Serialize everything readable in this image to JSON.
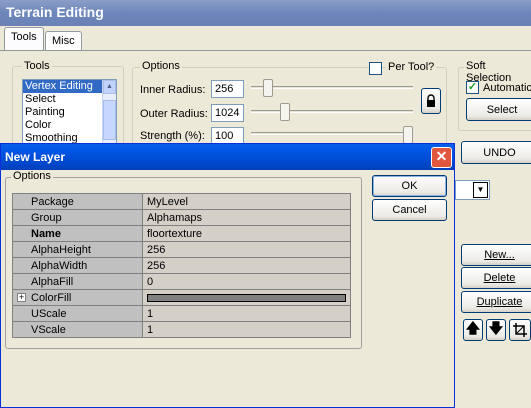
{
  "back_window": {
    "title": "Terrain Editing",
    "tabs": [
      {
        "label": "Tools"
      },
      {
        "label": "Misc"
      }
    ],
    "tools_group": {
      "label": "Tools",
      "items": [
        "Vertex Editing",
        "Select",
        "Painting",
        "Color",
        "Smoothing"
      ]
    },
    "options_group": {
      "label": "Options",
      "per_tool_label": "Per Tool?",
      "inner_radius_label": "Inner Radius:",
      "inner_radius_value": "256",
      "inner_radius_level": 0.08,
      "outer_radius_label": "Outer Radius:",
      "outer_radius_value": "1024",
      "outer_radius_level": 0.19,
      "strength_label": "Strength (%):",
      "strength_value": "100",
      "strength_level": 1.0
    },
    "soft_selection": {
      "label": "Soft Selection",
      "automatic_label": "Automatic",
      "automatic_checked": true,
      "select_label": "Select"
    },
    "undo_label": "UNDO",
    "new_label": "New...",
    "delete_label": "Delete",
    "duplicate_label": "Duplicate"
  },
  "dialog": {
    "title": "New Layer",
    "close_symbol": "✕",
    "options_label": "Options",
    "ok_label": "OK",
    "cancel_label": "Cancel",
    "properties": [
      {
        "key": "Package",
        "value": "MyLevel",
        "bold": false,
        "expandable": false
      },
      {
        "key": "Group",
        "value": "Alphamaps",
        "bold": false,
        "expandable": false
      },
      {
        "key": "Name",
        "value": "floortexture",
        "bold": true,
        "expandable": false
      },
      {
        "key": "AlphaHeight",
        "value": "256",
        "bold": false,
        "expandable": false
      },
      {
        "key": "AlphaWidth",
        "value": "256",
        "bold": false,
        "expandable": false
      },
      {
        "key": "AlphaFill",
        "value": "0",
        "bold": false,
        "expandable": false
      },
      {
        "key": "ColorFill",
        "value": "",
        "bold": false,
        "expandable": true,
        "color": "#808080"
      },
      {
        "key": "UScale",
        "value": "1",
        "bold": false,
        "expandable": false
      },
      {
        "key": "VScale",
        "value": "1",
        "bold": false,
        "expandable": false
      }
    ]
  },
  "icons": {
    "lock": "lock-icon",
    "up": "arrow-up-icon",
    "down": "arrow-down-icon",
    "crop": "crop-icon",
    "dropdown": "chevron-down-icon"
  }
}
